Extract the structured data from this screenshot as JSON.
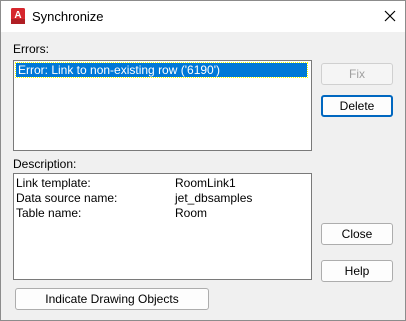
{
  "window": {
    "title": "Synchronize",
    "app_icon_letter": "A",
    "icon_color": "#d6262d"
  },
  "errors": {
    "label": "Errors:",
    "items": [
      "Error: Link to non-existing row ('6190')"
    ]
  },
  "description": {
    "label": "Description:",
    "rows": [
      {
        "key": "Link template:",
        "value": "RoomLink1"
      },
      {
        "key": "Data source name:",
        "value": "jet_dbsamples"
      },
      {
        "key": "Table name:",
        "value": "Room"
      }
    ]
  },
  "buttons": {
    "fix": "Fix",
    "delete": "Delete",
    "close": "Close",
    "help": "Help",
    "indicate": "Indicate Drawing Objects"
  },
  "colors": {
    "selection": "#0078d7",
    "accent": "#0067c0"
  }
}
